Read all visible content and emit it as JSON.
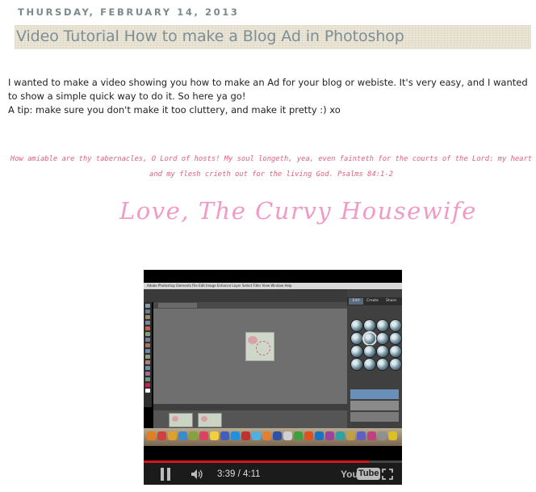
{
  "post": {
    "date": "THURSDAY, FEBRUARY 14, 2013",
    "title": "Video Tutorial How to make a Blog Ad in Photoshop",
    "paragraphs": [
      "I wanted to make a video showing you how to make an Ad for your blog or webiste. It's very easy, and I wanted to show a simple quick way to do it.  So here ya go!",
      "A tip: make sure you don't make it too cluttery, and make it pretty :)  xo"
    ],
    "verse": "How amiable are thy tabernacles, O Lord of hosts! My soul longeth, yea, even fainteth for the courts of the Lord: my heart and my flesh crieth out for the living God.   Psalms 84:1-2",
    "signature": "Love, The Curvy Housewife"
  },
  "video": {
    "current_time": "3:39",
    "duration": "4:11",
    "time_separator": "/",
    "progress": 0.872,
    "logo_you": "You",
    "logo_tube": "Tube",
    "screen": {
      "menubar_text": "Adobe Photoshop Elements  File  Edit  Image  Enhance  Layer  Select  Filter  View  Window  Help",
      "panel_tabs": [
        "Edit",
        "Create",
        "Share"
      ]
    },
    "colors": {
      "progress": "#cc181e",
      "controls_bg": "#1b1b1b",
      "panel_active_tab": "#5a6b80"
    }
  },
  "colors": {
    "date": "#7a8a8a",
    "title": "#7e8e95",
    "title_bg": "#e6e0cf",
    "verse": "#e0607a",
    "signature": "#f29ac6"
  }
}
